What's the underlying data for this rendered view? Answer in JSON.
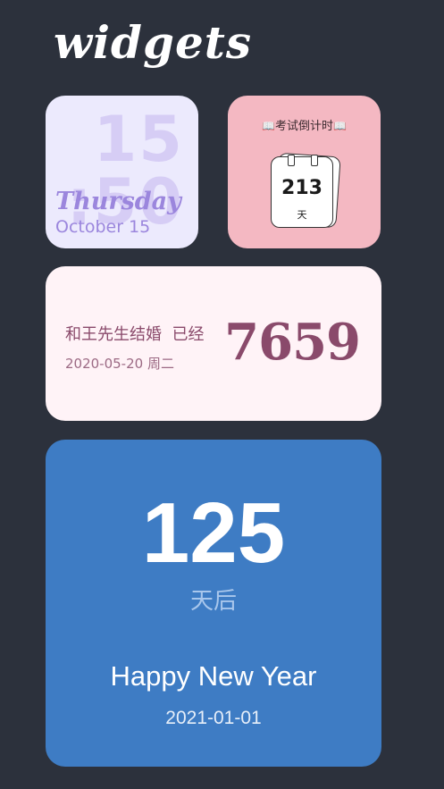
{
  "page": {
    "title": "widgets"
  },
  "clock_widget": {
    "hour": "15",
    "minute": ":50",
    "weekday": "Thursday",
    "date": "October 15",
    "background": "#eceafd",
    "accent": "#9b86dd"
  },
  "exam_widget": {
    "book_icon": "open-book-icon",
    "title": "考试倒计时",
    "days": "213",
    "unit": "天",
    "background": "#f4b8c2"
  },
  "anniversary_widget": {
    "text": "和王先生结婚  已经",
    "date": "2020-05-20 周二",
    "days": "7659",
    "background": "#fff3f7",
    "accent": "#8a4a6b"
  },
  "newyear_widget": {
    "days": "125",
    "unit": "天后",
    "title": "Happy New Year",
    "date": "2021-01-01",
    "background": "#3e7cc4"
  }
}
